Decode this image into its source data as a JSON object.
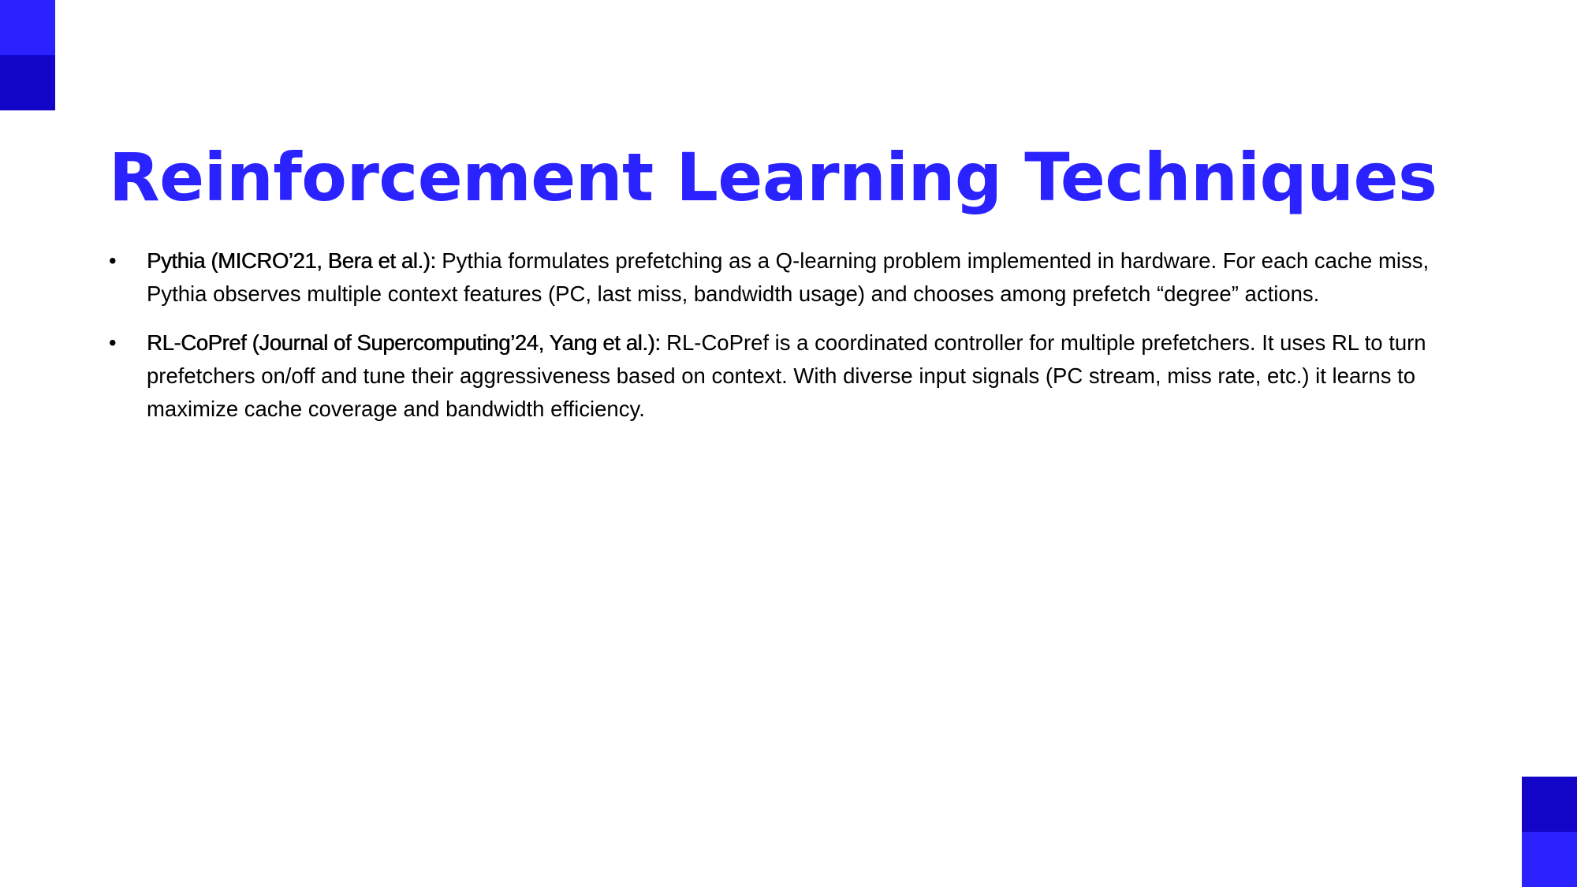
{
  "slide": {
    "title": "Reinforcement Learning Techniques",
    "bullet_symbol": "•",
    "bullets": [
      {
        "lead": "Pythia (MICRO’21, Bera et al.):",
        "text": " Pythia formulates prefetching as a Q-learning problem implemented in hardware. For each cache miss, Pythia observes multiple context features (PC, last miss, bandwidth usage) and chooses among prefetch “degree” actions."
      },
      {
        "lead": "RL-CoPref (Journal of Supercomputing’24, Yang et al.):",
        "text": " RL-CoPref is a coordinated controller for multiple prefetchers. It uses RL to turn prefetchers on/off and tune their aggressiveness based on context. With diverse input signals (PC stream, miss rate, etc.) it learns to maximize cache coverage and bandwidth efficiency."
      }
    ]
  },
  "colors": {
    "accent": "#2a22ff",
    "accent_dark": "#1205c8"
  }
}
